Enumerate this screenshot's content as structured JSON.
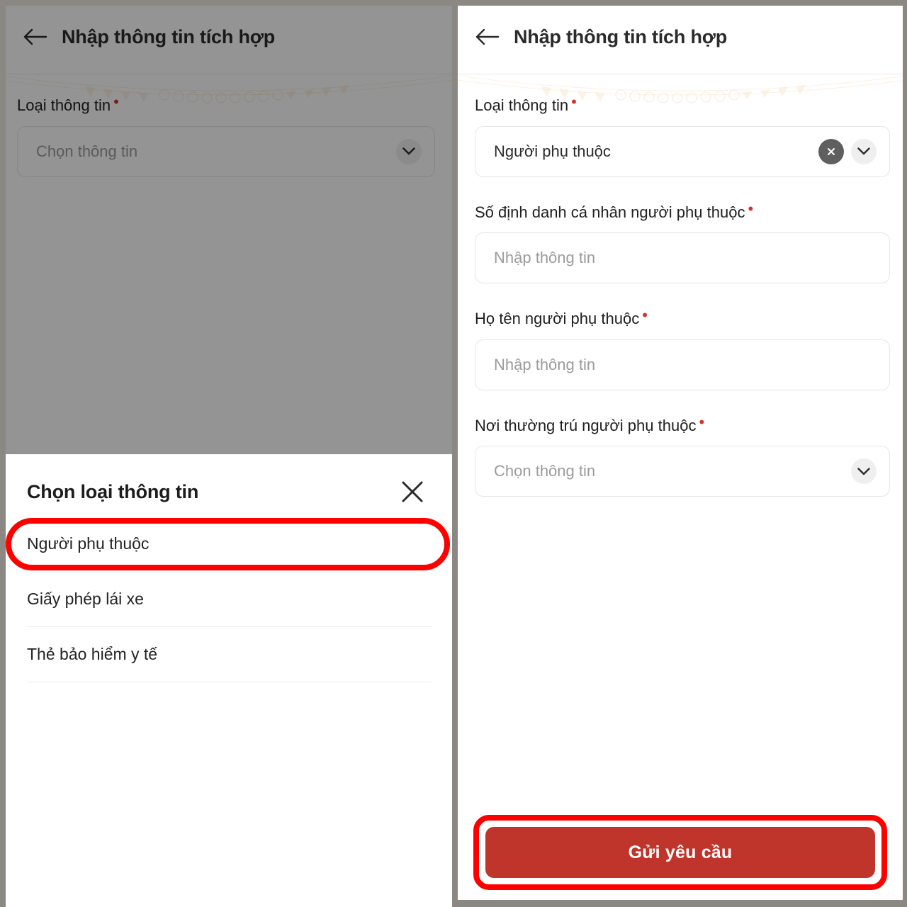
{
  "left_panel": {
    "header": {
      "title": "Nhập thông tin tích hợp",
      "back_icon": "back-arrow-icon"
    },
    "fields": [
      {
        "label": "Loại thông tin",
        "required": true,
        "value": "",
        "placeholder": "Chọn thông tin",
        "type": "select"
      }
    ],
    "bottom_sheet": {
      "title": "Chọn loại thông tin",
      "close_icon": "close-icon",
      "options": [
        {
          "label": "Người phụ thuộc",
          "highlighted": true
        },
        {
          "label": "Giấy phép lái xe",
          "highlighted": false
        },
        {
          "label": "Thẻ bảo hiểm y tế",
          "highlighted": false
        }
      ]
    }
  },
  "right_panel": {
    "header": {
      "title": "Nhập thông tin tích hợp",
      "back_icon": "back-arrow-icon"
    },
    "fields": [
      {
        "label": "Loại thông tin",
        "required": true,
        "value": "Người phụ thuộc",
        "placeholder": "Chọn thông tin",
        "type": "select-filled"
      },
      {
        "label": "Số định danh cá nhân người phụ thuộc",
        "required": true,
        "value": "",
        "placeholder": "Nhập thông tin",
        "type": "text"
      },
      {
        "label": "Họ tên người phụ thuộc",
        "required": true,
        "value": "",
        "placeholder": "Nhập thông tin",
        "type": "text"
      },
      {
        "label": "Nơi thường trú người phụ thuộc",
        "required": true,
        "value": "",
        "placeholder": "Chọn thông tin",
        "type": "select"
      }
    ],
    "submit": {
      "label": "Gửi yêu cầu",
      "highlighted": true
    }
  },
  "colors": {
    "submit_bg": "#c0352b",
    "highlight_ring": "#ff0000",
    "required_dot": "#d0342c",
    "backdrop": "#8b8884",
    "placeholder_text": "#9b9b9b"
  },
  "markers": {
    "required_symbol": "•"
  }
}
